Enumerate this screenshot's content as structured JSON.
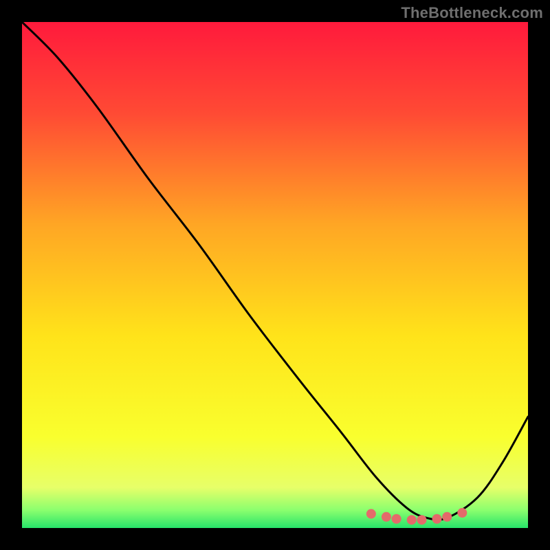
{
  "watermark": "TheBottleneck.com",
  "chart_data": {
    "type": "line",
    "title": "",
    "xlabel": "",
    "ylabel": "",
    "xlim": [
      0,
      1
    ],
    "ylim": [
      0,
      1
    ],
    "x": [
      0.0,
      0.07,
      0.15,
      0.25,
      0.35,
      0.45,
      0.55,
      0.63,
      0.7,
      0.76,
      0.8,
      0.84,
      0.9,
      0.95,
      1.0
    ],
    "values": [
      1.0,
      0.93,
      0.83,
      0.69,
      0.56,
      0.42,
      0.29,
      0.19,
      0.1,
      0.04,
      0.02,
      0.02,
      0.06,
      0.13,
      0.22
    ],
    "series": [
      {
        "name": "curve",
        "x": [
          0.0,
          0.07,
          0.15,
          0.25,
          0.35,
          0.45,
          0.55,
          0.63,
          0.7,
          0.76,
          0.8,
          0.84,
          0.9,
          0.95,
          1.0
        ],
        "y": [
          1.0,
          0.93,
          0.83,
          0.69,
          0.56,
          0.42,
          0.29,
          0.19,
          0.1,
          0.04,
          0.02,
          0.02,
          0.06,
          0.13,
          0.22
        ]
      },
      {
        "name": "trough-markers",
        "x": [
          0.69,
          0.72,
          0.74,
          0.77,
          0.79,
          0.82,
          0.84,
          0.87
        ],
        "y": [
          0.028,
          0.022,
          0.018,
          0.016,
          0.016,
          0.018,
          0.022,
          0.03
        ]
      }
    ],
    "gradient_stops": [
      {
        "pos": 0.0,
        "color": "#ff1a3c"
      },
      {
        "pos": 0.18,
        "color": "#ff4a34"
      },
      {
        "pos": 0.4,
        "color": "#ffa624"
      },
      {
        "pos": 0.62,
        "color": "#ffe31a"
      },
      {
        "pos": 0.82,
        "color": "#f9ff2e"
      },
      {
        "pos": 0.92,
        "color": "#e7ff69"
      },
      {
        "pos": 0.965,
        "color": "#8aff6e"
      },
      {
        "pos": 1.0,
        "color": "#27e36a"
      }
    ],
    "marker_color": "#e46a6a",
    "curve_color": "#000000"
  }
}
